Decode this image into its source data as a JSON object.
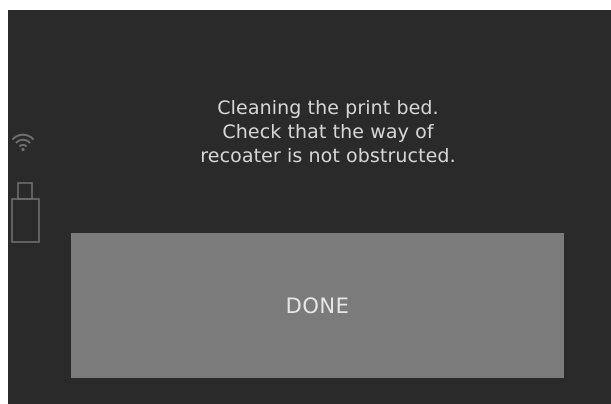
{
  "message": {
    "lines": [
      "Cleaning the print bed.",
      "Check that the way of",
      "recoater is not obstructed."
    ]
  },
  "actions": {
    "done_label": "DONE"
  },
  "status": {
    "wifi_icon": "wifi-icon",
    "usb_icon": "usb-drive-icon"
  },
  "colors": {
    "background": "#2a2a2a",
    "button": "#7b7b7b",
    "text": "#d7d7d7"
  }
}
